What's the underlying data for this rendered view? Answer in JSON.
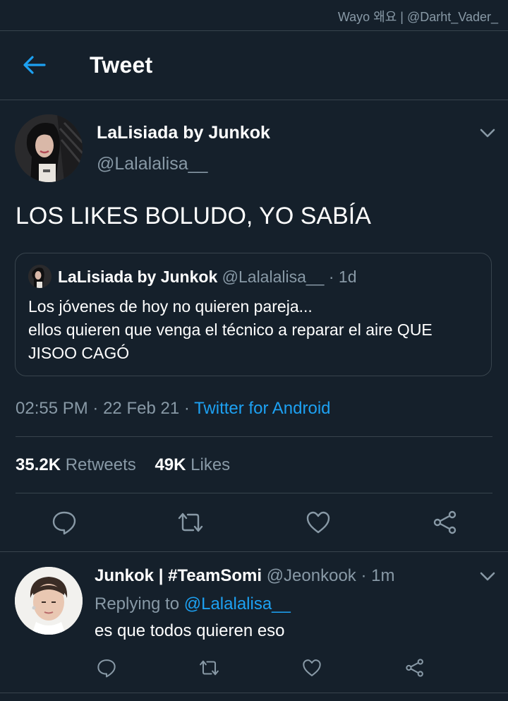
{
  "watermark": "Wayo 왜요 | @Darht_Vader_",
  "header": {
    "title": "Tweet"
  },
  "tweet": {
    "author_name": "LaLisiada by Junkok",
    "author_handle": "@Lalalalisa__",
    "text": "LOS LIKES BOLUDO, YO SABÍA",
    "quoted": {
      "author_name": "LaLisiada by Junkok",
      "author_handle": "@Lalalalisa__",
      "separator": "·",
      "age": "1d",
      "lines": [
        "Los jóvenes de hoy no quieren pareja...",
        "ellos quieren que venga el técnico a reparar el aire QUE",
        "JISOO CAGÓ"
      ]
    },
    "time": "02:55 PM",
    "date": "22 Feb 21",
    "separator": "·",
    "source": "Twitter for Android",
    "retweets_count": "35.2K",
    "retweets_label": "Retweets",
    "likes_count": "49K",
    "likes_label": "Likes"
  },
  "reply": {
    "author_name": "Junkok | #TeamSomi",
    "author_handle": "@Jeonkook",
    "separator": "·",
    "age": "1m",
    "replying_to_label": "Replying to",
    "replying_to_handle": "@Lalalalisa__",
    "text": "es que todos quieren eso"
  },
  "icons": [
    "back-arrow-icon",
    "chevron-down-icon",
    "reply-icon",
    "retweet-icon",
    "like-icon",
    "share-icon"
  ],
  "colors": {
    "background": "#15202b",
    "accent": "#1da1f2",
    "muted": "#8899a6",
    "divider": "#38444d"
  }
}
